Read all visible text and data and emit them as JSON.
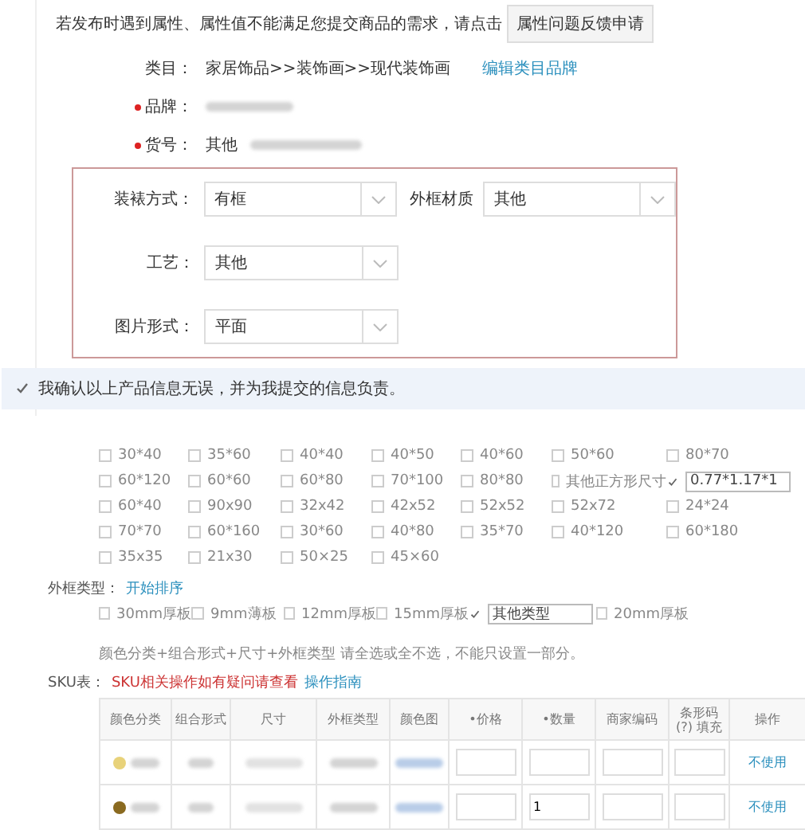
{
  "notice": {
    "text": "若发布时遇到属性、属性值不能满足您提交商品的需求，请点击",
    "button": "属性问题反馈申请"
  },
  "fields": [
    {
      "label": "类目：",
      "required": false,
      "value": "家居饰品>>装饰画>>现代装饰画",
      "link": "编辑类目品牌",
      "blurred": false
    },
    {
      "label": "品牌：",
      "required": true,
      "blurred": true
    },
    {
      "label": "货号：",
      "required": true,
      "value": "其他",
      "blurred": true
    }
  ],
  "attributes": [
    [
      {
        "label": "装裱方式：",
        "value": "有框"
      },
      {
        "label": "外框材质",
        "value": "其他"
      }
    ],
    [
      {
        "label": "工艺：",
        "value": "其他"
      }
    ],
    [
      {
        "label": "图片形式：",
        "value": "平面"
      }
    ]
  ],
  "confirm": {
    "text": "我确认以上产品信息无误，并为我提交的信息负责。",
    "checked": true
  },
  "sizes": [
    {
      "label": "30*40",
      "checked": false
    },
    {
      "label": "35*60",
      "checked": false
    },
    {
      "label": "40*40",
      "checked": false
    },
    {
      "label": "40*50",
      "checked": false
    },
    {
      "label": "40*60",
      "checked": false
    },
    {
      "label": "50*60",
      "checked": false
    },
    {
      "label": "80*70",
      "checked": false
    },
    {
      "label": "60*120",
      "checked": false
    },
    {
      "label": "60*60",
      "checked": false
    },
    {
      "label": "60*80",
      "checked": false
    },
    {
      "label": "70*100",
      "checked": false
    },
    {
      "label": "80*80",
      "checked": false
    },
    {
      "label": "其他正方形尺寸",
      "checked": false
    },
    {
      "value": "0.77*1.17*1",
      "checked": true
    },
    {
      "label": "60*40",
      "checked": false
    },
    {
      "label": "90x90",
      "checked": false
    },
    {
      "label": "32x42",
      "checked": false
    },
    {
      "label": "42x52",
      "checked": false
    },
    {
      "label": "52x52",
      "checked": false
    },
    {
      "label": "52x72",
      "checked": false
    },
    {
      "label": "24*24",
      "checked": false
    },
    {
      "label": "70*70",
      "checked": false
    },
    {
      "label": "60*160",
      "checked": false
    },
    {
      "label": "30*60",
      "checked": false
    },
    {
      "label": "40*80",
      "checked": false
    },
    {
      "label": "35*70",
      "checked": false
    },
    {
      "label": "40*120",
      "checked": false
    },
    {
      "label": "60*180",
      "checked": false
    },
    {
      "label": "35x35",
      "checked": false
    },
    {
      "label": "21x30",
      "checked": false
    },
    {
      "label": "50×25",
      "checked": false
    },
    {
      "label": "45×60",
      "checked": false
    }
  ],
  "frame_type": {
    "label": "外框类型：",
    "link": "开始排序",
    "options": [
      {
        "label": "30mm厚板",
        "checked": false
      },
      {
        "label": "9mm薄板",
        "checked": false
      },
      {
        "label": "12mm厚板",
        "checked": false
      },
      {
        "label": "15mm厚板",
        "checked": false
      },
      {
        "value": "其他类型",
        "checked": true
      },
      {
        "label": "20mm厚板",
        "checked": false
      }
    ]
  },
  "note": "颜色分类+组合形式+尺寸+外框类型 请全选或全不选，不能只设置一部分。",
  "sku": {
    "label": "SKU表：",
    "warning": "SKU相关操作如有疑问请查看",
    "link": "操作指南",
    "columns": [
      "颜色分类",
      "组合形式",
      "尺寸",
      "外框类型",
      "颜色图",
      "•价格",
      "•数量",
      "商家编码",
      "条形码 (?) 填充",
      "操作"
    ],
    "rows": [
      {
        "color": "#e8d27a",
        "action": "不使用"
      },
      {
        "color": "#8a6a20",
        "quantity": "1",
        "action": "不使用"
      }
    ]
  }
}
